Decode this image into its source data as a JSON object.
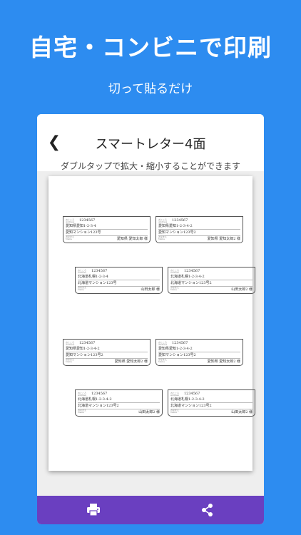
{
  "headline": "自宅・コンビニで印刷",
  "subline": "切って貼るだけ",
  "app": {
    "title": "スマートレター4面",
    "back_icon": "chevron-left-icon",
    "hint": "ダブルタップで拡大・縮小することができます"
  },
  "labels": [
    {
      "zip_cap": "おところ",
      "zip_cap2": "Address",
      "zip": "1234567",
      "line1": "愛知県愛知1-2-3-4",
      "line2": "愛知マンション123号",
      "name_cap": "おなまえ",
      "name_cap2": "Name",
      "recipient": "愛知県 愛知太郎 様"
    },
    {
      "zip_cap": "おところ",
      "zip_cap2": "Address",
      "zip": "1234567",
      "line1": "愛知県愛知1-2-3-4-2",
      "line2": "愛知マンション123号2",
      "name_cap": "おなまえ",
      "name_cap2": "Name",
      "recipient": "愛知県 愛知太郎2 様"
    },
    {
      "zip_cap": "おところ",
      "zip_cap2": "address",
      "zip": "1234567",
      "line1": "北海道札幌1-2-3-4",
      "line2": "北海道マンション123号",
      "name_cap": "おなまえ",
      "name_cap2": "Name",
      "recipient": "山田太郎 様"
    },
    {
      "zip_cap": "おところ",
      "zip_cap2": "address",
      "zip": "1234567",
      "line1": "北海道札幌1-2-3-4-2",
      "line2": "北海道マンション123号2",
      "name_cap": "おなまえ",
      "name_cap2": "Name",
      "recipient": "山田太郎2 様"
    },
    {
      "zip_cap": "おところ",
      "zip_cap2": "Address",
      "zip": "1234567",
      "line1": "愛知県愛知1-2-3-4-2",
      "line2": "愛知マンション123号2",
      "name_cap": "おなまえ",
      "name_cap2": "Name",
      "recipient": "愛知県 愛知太郎2 様"
    },
    {
      "zip_cap": "おところ",
      "zip_cap2": "Address",
      "zip": "1234567",
      "line1": "愛知県愛知1-2-3-4-2",
      "line2": "愛知マンション123号2",
      "name_cap": "おなまえ",
      "name_cap2": "Name",
      "recipient": "愛知県 愛知太郎2 様"
    },
    {
      "zip_cap": "おところ",
      "zip_cap2": "address",
      "zip": "1234567",
      "line1": "北海道札幌1-2-3-4-2",
      "line2": "北海道マンション123号2",
      "name_cap": "おなまえ",
      "name_cap2": "Name",
      "recipient": "山田太郎2 様"
    },
    {
      "zip_cap": "おところ",
      "zip_cap2": "address",
      "zip": "1234567",
      "line1": "北海道札幌1-2-3-4-2",
      "line2": "北海道マンション123号2",
      "name_cap": "おなまえ",
      "name_cap2": "Name",
      "recipient": "山田太郎2 様"
    }
  ],
  "toolbar": {
    "print_icon": "printer-icon",
    "share_icon": "share-icon"
  },
  "colors": {
    "background": "#2d8cf0",
    "bottom_bar": "#6a3fc0"
  }
}
